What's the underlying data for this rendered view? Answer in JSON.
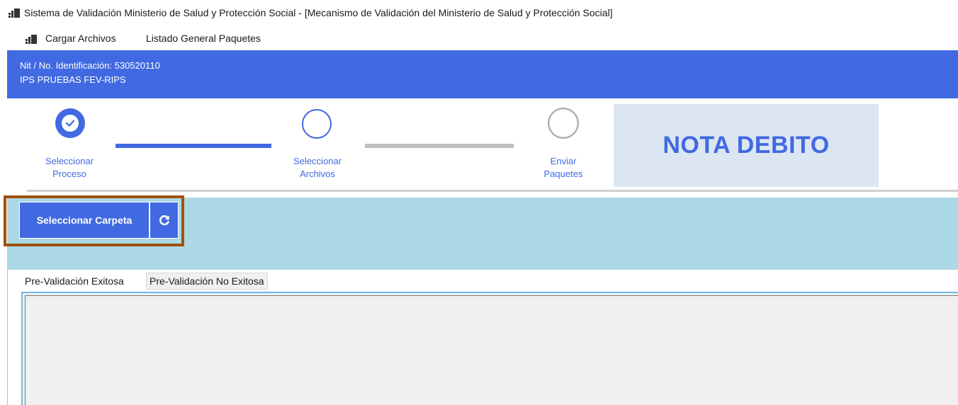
{
  "window": {
    "title": "Sistema de Validación Ministerio de Salud y Protección Social - [Mecanismo de Validación del Ministerio de Salud y Protección Social]"
  },
  "menu": {
    "items": [
      "Cargar Archivos",
      "Listado General Paquetes"
    ]
  },
  "header": {
    "nit_line": "Nit / No. Identificación: 530520110",
    "name_line": "IPS PRUEBAS FEV-RIPS"
  },
  "stepper": {
    "steps": [
      {
        "label_1": "Seleccionar",
        "label_2": "Proceso",
        "state": "completed"
      },
      {
        "label_1": "Seleccionar",
        "label_2": "Archivos",
        "state": "current"
      },
      {
        "label_1": "Enviar",
        "label_2": "Paquetes",
        "state": "pending"
      }
    ],
    "document_type": "NOTA DEBITO"
  },
  "actions": {
    "select_folder_label": "Seleccionar Carpeta",
    "refresh_icon": "refresh-icon"
  },
  "tabs": [
    {
      "label": "Pre-Validación Exitosa",
      "selected": true
    },
    {
      "label": "Pre-Validación No Exitosa",
      "selected": false
    }
  ],
  "colors": {
    "primary": "#4169e1",
    "band": "#add8e6",
    "nota_bg": "#dce6f2",
    "highlight": "#a0520f",
    "pending_bar": "#c0c0c0"
  }
}
